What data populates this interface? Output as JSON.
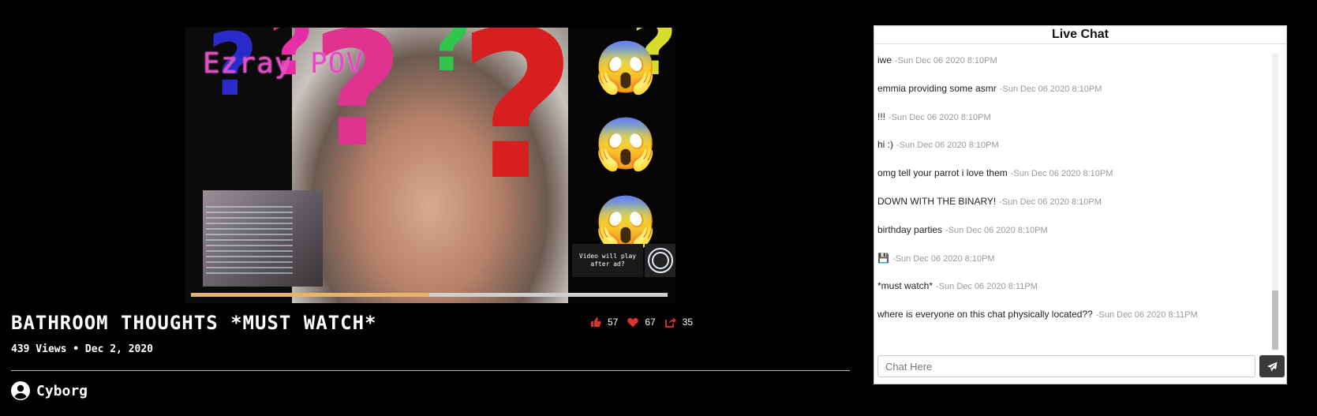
{
  "video": {
    "overlay_text": "Ezray POV",
    "ad_notice": "Video will play after ad?",
    "progress": 0.5
  },
  "info": {
    "title": "BATHROOM THOUGHTS *MUST WATCH*",
    "meta": "439 Views • Dec 2, 2020",
    "likes": "57",
    "hearts": "67",
    "shares": "35",
    "channel": "Cyborg"
  },
  "colors": {
    "accent": "#e03131",
    "progress_fill": "#e7b468",
    "send_button": "#3a3a3a"
  },
  "chat": {
    "title": "Live Chat",
    "messages": [
      {
        "text": "iwe",
        "time": "-Sun Dec 06 2020 8:10PM"
      },
      {
        "text": "emmia providing some asmr",
        "time": "-Sun Dec 06 2020 8:10PM"
      },
      {
        "text": "!!!",
        "time": "-Sun Dec 06 2020 8:10PM"
      },
      {
        "text": "hi :)",
        "time": "-Sun Dec 06 2020 8:10PM"
      },
      {
        "text": "omg tell your parrot i love them",
        "time": "-Sun Dec 06 2020 8:10PM"
      },
      {
        "text": "DOWN WITH THE BINARY!",
        "time": "-Sun Dec 06 2020 8:10PM"
      },
      {
        "text": "birthday parties",
        "time": "-Sun Dec 06 2020 8:10PM"
      },
      {
        "text": "💾",
        "time": "-Sun Dec 06 2020 8:10PM"
      },
      {
        "text": "*must watch*",
        "time": "-Sun Dec 06 2020 8:11PM"
      },
      {
        "text": "where is everyone on this chat physically located??",
        "time": "-Sun Dec 06 2020 8:11PM"
      }
    ],
    "input_placeholder": "Chat Here"
  }
}
